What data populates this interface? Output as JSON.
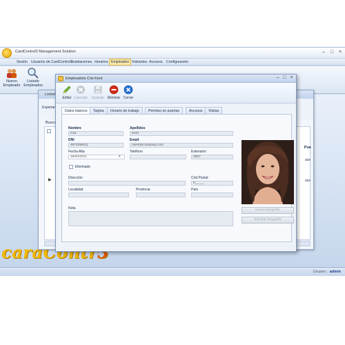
{
  "app": {
    "title": "CardControl3 Management Solution",
    "brand_text": "caraContr",
    "brand_suffix": "3"
  },
  "menu": [
    "Sesión",
    "Usuarios de CardControl3",
    "Instalaciones",
    "Horarios",
    "Empleados",
    "Visitantes",
    "Accesos",
    "Configuración"
  ],
  "ribbon": {
    "new_employee": "Nuevo Empleado",
    "list_employees": "Listado Empleados"
  },
  "status": {
    "user_label": "Usuario:",
    "user": "admin"
  },
  "list_window": {
    "title": "Listado",
    "export_label": "Exportar d",
    "search_label": "Buscar",
    "column_right": "Pue",
    "cells": [
      "ace",
      "ace"
    ]
  },
  "dialog": {
    "title": "Empleado/a Cris Kent",
    "toolbar": {
      "edit": "Editar",
      "cancel": "Cancelar",
      "save": "Guardar",
      "delete": "Eliminar",
      "close": "Cerrar"
    },
    "tabs": [
      "Datos básicos",
      "Tarjeta",
      "Horario de trabajo",
      "Permiso en puertas",
      "Accesos",
      "Visitas"
    ],
    "fields": {
      "nombre_label": "Nombre",
      "nombre": "Cris",
      "apellidos_label": "Apellidos",
      "apellidos": "Kent",
      "dni_label": "DNI",
      "dni": "45742591Q",
      "email_label": "Email",
      "email": "ckent@company.com",
      "fecha_alta_label": "Fecha Alta",
      "fecha_alta": "15/04/2011",
      "telefono_label": "Teléfono",
      "telefono": "",
      "extension_label": "Extensión",
      "extension": "2007",
      "eliminado_label": "Eliminado",
      "direccion_label": "Dirección",
      "direccion": "",
      "cod_postal_label": "Cód.Postal",
      "cod_postal": "0_____",
      "localidad_label": "Localidad",
      "provincia_label": "Provincia",
      "pais_label": "País",
      "nota_label": "Nota"
    },
    "photo_buttons": {
      "new_photo": "Nueva fotografía",
      "delete_photo": "Eliminar fotografía"
    }
  },
  "colors": {
    "brand": "#f2b800",
    "accent": "#1d3d8a",
    "window_bg": "#c9d9ee",
    "delete_red": "#d42a16",
    "close_blue": "#1f6fd6"
  },
  "icons": [
    "app-logo-icon",
    "new-employee-icon",
    "search-icon",
    "edit-icon",
    "cancel-icon",
    "save-icon",
    "delete-icon",
    "close-icon",
    "calendar-icon"
  ]
}
